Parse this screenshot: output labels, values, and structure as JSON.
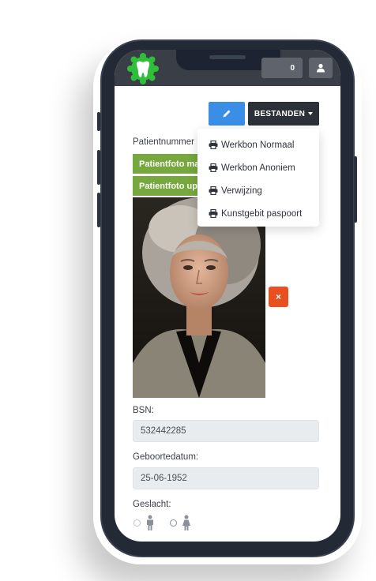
{
  "header": {
    "badge_count": "0",
    "logo_icon": "tooth-logo-icon",
    "user_icon": "user-icon"
  },
  "toolbar": {
    "files_label": "BESTANDEN",
    "edit_icon": "pencil-icon"
  },
  "dropdown": {
    "items": [
      {
        "label": "Werkbon Normaal",
        "icon": "printer-icon"
      },
      {
        "label": "Werkbon Anoniem",
        "icon": "printer-icon"
      },
      {
        "label": "Verwijzing",
        "icon": "printer-icon"
      },
      {
        "label": "Kunstgebit paspoort",
        "icon": "printer-icon"
      }
    ]
  },
  "patient": {
    "number_label": "Patientnummer",
    "photo_button_1": "Patientfoto maken",
    "photo_button_2": "Patientfoto uploaden",
    "delete_label": "×",
    "bsn_label": "BSN:",
    "bsn_value": "532442285",
    "dob_label": "Geboortedatum:",
    "dob_value": "25-06-1952",
    "gender_label": "Geslacht:",
    "gender_options": [
      "male",
      "female"
    ]
  },
  "colors": {
    "accent_blue": "#3a8ee6",
    "dark_button": "#2c3038",
    "green_button": "#76a83d",
    "delete_red": "#e8501f",
    "logo_green": "#2fbf3a"
  }
}
